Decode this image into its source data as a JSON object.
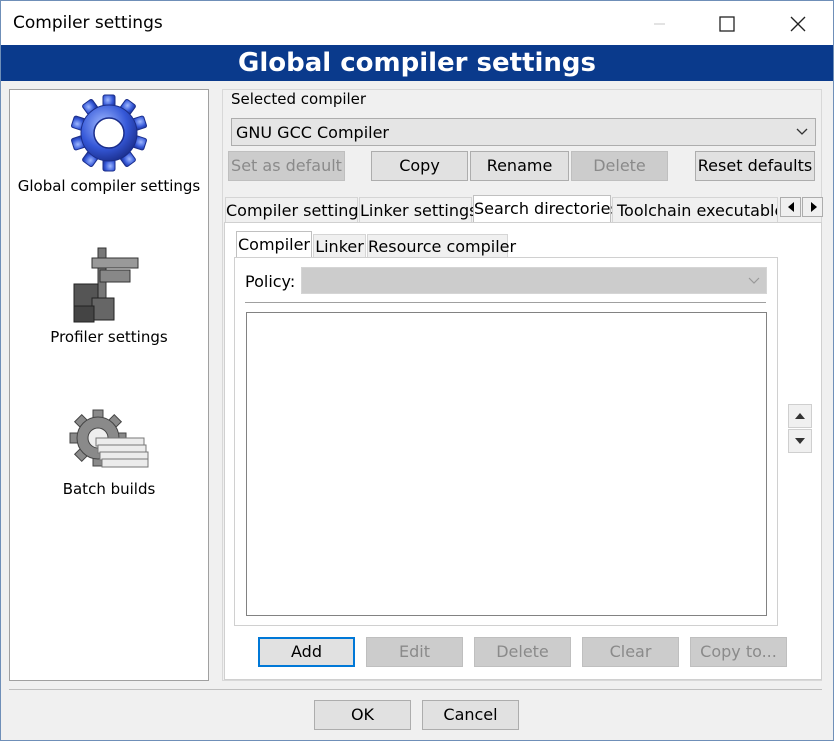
{
  "window": {
    "title": "Compiler settings",
    "banner": "Global compiler settings"
  },
  "sidebar": {
    "items": [
      {
        "label": "Global compiler settings",
        "icon": "gear-icon"
      },
      {
        "label": "Profiler settings",
        "icon": "profiler-icon"
      },
      {
        "label": "Batch builds",
        "icon": "batch-builds-icon"
      }
    ]
  },
  "compiler": {
    "group_label": "Selected compiler",
    "selected": "GNU GCC Compiler",
    "buttons": {
      "set_default": "Set as default",
      "copy": "Copy",
      "rename": "Rename",
      "delete": "Delete",
      "reset": "Reset defaults"
    }
  },
  "tabs": [
    "Compiler settings",
    "Linker settings",
    "Search directories",
    "Toolchain executables"
  ],
  "subtabs": [
    "Compiler",
    "Linker",
    "Resource compiler"
  ],
  "policy": {
    "label": "Policy:",
    "value": ""
  },
  "list_buttons": {
    "add": "Add",
    "edit": "Edit",
    "delete": "Delete",
    "clear": "Clear",
    "copy_to": "Copy to..."
  },
  "dialog": {
    "ok": "OK",
    "cancel": "Cancel"
  }
}
